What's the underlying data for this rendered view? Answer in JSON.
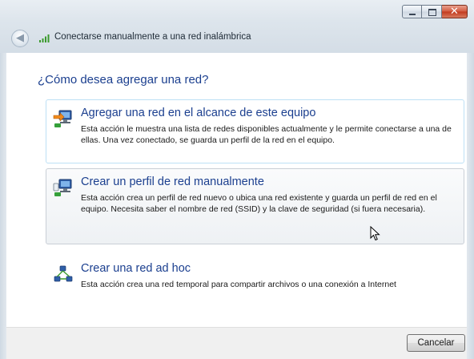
{
  "window": {
    "title": "Conectarse manualmente a una red inalámbrica",
    "close_glyph": "✕",
    "back_glyph": "◀"
  },
  "question": "¿Cómo desea agregar una red?",
  "options": [
    {
      "title": "Agregar una red en el alcance de este equipo",
      "description": "Esta acción le muestra una lista de redes disponibles actualmente y le permite conectarse a una de ellas. Una vez conectado, se guarda un perfil de la red en el equipo.",
      "icon": "network-add-icon",
      "state": "focused"
    },
    {
      "title": "Crear un perfil de red manualmente",
      "description": "Esta acción crea un perfil de red nuevo o ubica una red existente y guarda un perfil de red en el equipo. Necesita saber el nombre de red (SSID) y la clave de seguridad (si fuera necesaria).",
      "icon": "network-profile-icon",
      "state": "hovered"
    },
    {
      "title": "Crear una red ad hoc",
      "description": "Esta acción crea una red temporal para compartir archivos o una conexión a Internet",
      "icon": "adhoc-network-icon",
      "state": "normal"
    }
  ],
  "footer": {
    "cancel_label": "Cancelar"
  },
  "colors": {
    "link_blue": "#1b3f8f",
    "focus_border": "#bde0f5",
    "footer_bg": "#f0f0f0"
  }
}
